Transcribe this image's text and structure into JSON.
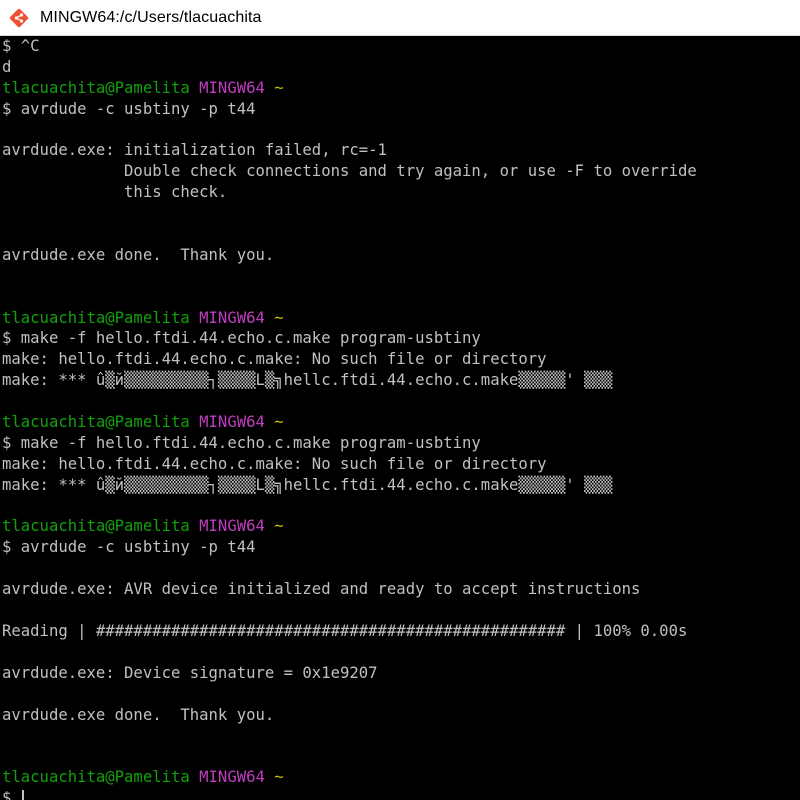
{
  "window": {
    "title": "MINGW64:/c/Users/tlacuachita",
    "icon": "git-bash-icon",
    "colors": {
      "background": "#000000",
      "text": "#c0c0c0",
      "user_host": "#13a10e",
      "shell_name": "#c13dc0",
      "path": "#c8c000"
    }
  },
  "terminal": {
    "lines": [
      [
        {
          "t": "$ ^C",
          "c": "default"
        }
      ],
      [
        {
          "t": "d",
          "c": "default"
        }
      ],
      [
        {
          "t": "tlacuachita@Pamelita",
          "c": "green"
        },
        {
          "t": " ",
          "c": "default"
        },
        {
          "t": "MINGW64",
          "c": "magenta"
        },
        {
          "t": " ",
          "c": "default"
        },
        {
          "t": "~",
          "c": "yellow"
        }
      ],
      [
        {
          "t": "$ avrdude -c usbtiny -p t44",
          "c": "default"
        }
      ],
      [
        {
          "t": "",
          "c": "default"
        }
      ],
      [
        {
          "t": "avrdude.exe: initialization failed, rc=-1",
          "c": "default"
        }
      ],
      [
        {
          "t": "             Double check connections and try again, or use -F to override",
          "c": "default"
        }
      ],
      [
        {
          "t": "             this check.",
          "c": "default"
        }
      ],
      [
        {
          "t": "",
          "c": "default"
        }
      ],
      [
        {
          "t": "",
          "c": "default"
        }
      ],
      [
        {
          "t": "avrdude.exe done.  Thank you.",
          "c": "default"
        }
      ],
      [
        {
          "t": "",
          "c": "default"
        }
      ],
      [
        {
          "t": "",
          "c": "default"
        }
      ],
      [
        {
          "t": "tlacuachita@Pamelita",
          "c": "green"
        },
        {
          "t": " ",
          "c": "default"
        },
        {
          "t": "MINGW64",
          "c": "magenta"
        },
        {
          "t": " ",
          "c": "default"
        },
        {
          "t": "~",
          "c": "yellow"
        }
      ],
      [
        {
          "t": "$ make -f hello.ftdi.44.echo.c.make program-usbtiny",
          "c": "default"
        }
      ],
      [
        {
          "t": "make: hello.ftdi.44.echo.c.make: No such file or directory",
          "c": "default"
        }
      ],
      [
        {
          "t": "make: *** û▒й▒▒▒▒▒▒▒▒▒┐▒▒▒▒L▒╗hellc.ftdi.44.echo.c.make▒▒▒▒▒' ▒▒▒",
          "c": "default"
        }
      ],
      [
        {
          "t": "",
          "c": "default"
        }
      ],
      [
        {
          "t": "tlacuachita@Pamelita",
          "c": "green"
        },
        {
          "t": " ",
          "c": "default"
        },
        {
          "t": "MINGW64",
          "c": "magenta"
        },
        {
          "t": " ",
          "c": "default"
        },
        {
          "t": "~",
          "c": "yellow"
        }
      ],
      [
        {
          "t": "$ make -f hello.ftdi.44.echo.c.make program-usbtiny",
          "c": "default"
        }
      ],
      [
        {
          "t": "make: hello.ftdi.44.echo.c.make: No such file or directory",
          "c": "default"
        }
      ],
      [
        {
          "t": "make: *** û▒й▒▒▒▒▒▒▒▒▒┐▒▒▒▒L▒╗hellc.ftdi.44.echo.c.make▒▒▒▒▒' ▒▒▒",
          "c": "default"
        }
      ],
      [
        {
          "t": "",
          "c": "default"
        }
      ],
      [
        {
          "t": "tlacuachita@Pamelita",
          "c": "green"
        },
        {
          "t": " ",
          "c": "default"
        },
        {
          "t": "MINGW64",
          "c": "magenta"
        },
        {
          "t": " ",
          "c": "default"
        },
        {
          "t": "~",
          "c": "yellow"
        }
      ],
      [
        {
          "t": "$ avrdude -c usbtiny -p t44",
          "c": "default"
        }
      ],
      [
        {
          "t": "",
          "c": "default"
        }
      ],
      [
        {
          "t": "avrdude.exe: AVR device initialized and ready to accept instructions",
          "c": "default"
        }
      ],
      [
        {
          "t": "",
          "c": "default"
        }
      ],
      [
        {
          "t": "Reading | ################################################## | 100% 0.00s",
          "c": "default"
        }
      ],
      [
        {
          "t": "",
          "c": "default"
        }
      ],
      [
        {
          "t": "avrdude.exe: Device signature = 0x1e9207",
          "c": "default"
        }
      ],
      [
        {
          "t": "",
          "c": "default"
        }
      ],
      [
        {
          "t": "avrdude.exe done.  Thank you.",
          "c": "default"
        }
      ],
      [
        {
          "t": "",
          "c": "default"
        }
      ],
      [
        {
          "t": "",
          "c": "default"
        }
      ],
      [
        {
          "t": "tlacuachita@Pamelita",
          "c": "green"
        },
        {
          "t": " ",
          "c": "default"
        },
        {
          "t": "MINGW64",
          "c": "magenta"
        },
        {
          "t": " ",
          "c": "default"
        },
        {
          "t": "~",
          "c": "yellow"
        }
      ],
      [
        {
          "t": "$ ",
          "c": "default"
        }
      ]
    ]
  }
}
